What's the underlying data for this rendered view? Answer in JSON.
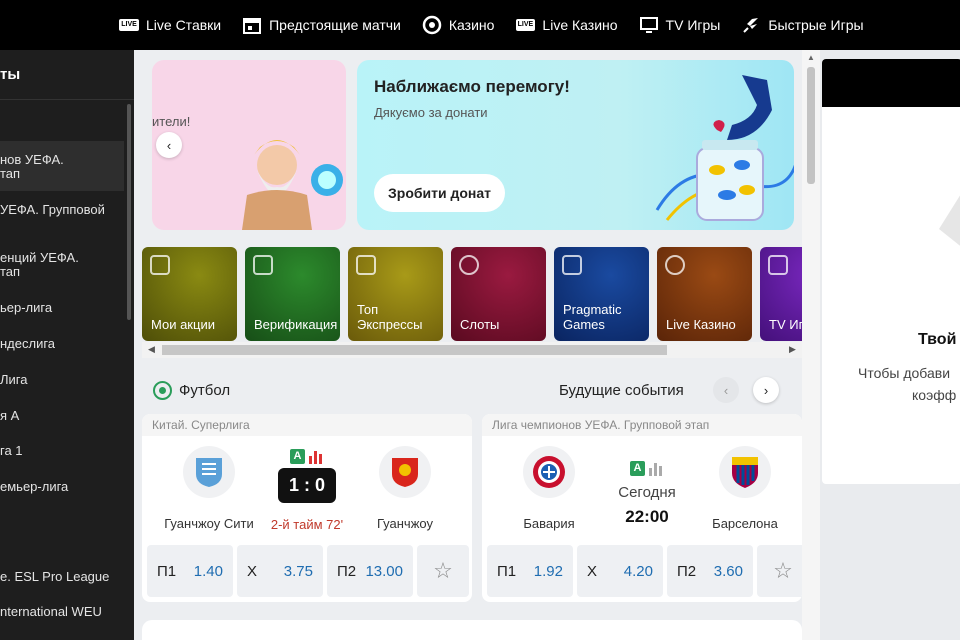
{
  "top_nav": [
    {
      "label": "Live Ставки",
      "icon": "live-badge-icon"
    },
    {
      "label": "Предстоящие матчи",
      "icon": "calendar-icon"
    },
    {
      "label": "Казино",
      "icon": "casino-chip-icon"
    },
    {
      "label": "Live Казино",
      "icon": "live-badge-icon"
    },
    {
      "label": "TV Игры",
      "icon": "tv-icon"
    },
    {
      "label": "Быстрые Игры",
      "icon": "rocket-icon"
    }
  ],
  "live_badge_text": "LIVE",
  "sidebar": {
    "title": "ты",
    "items": [
      "нов УЕФА.",
      "тап",
      " УЕФА. Групповой",
      "енций УЕФА.",
      "тап",
      "ьер-лига",
      "ндеслига",
      "Лига",
      "я А",
      "га 1",
      "емьер-лига",
      "e. ESL Pro League",
      "nternational WEU"
    ]
  },
  "banner_left": {
    "text": "ители!",
    "arrow": "‹"
  },
  "banner_right": {
    "title": "Наближаємо перемогу!",
    "subtitle": "Дякуємо за донати",
    "button": "Зробити донат"
  },
  "tiles": [
    {
      "label": "Мои акции",
      "color": "#6b6a0e"
    },
    {
      "label": "Верификация",
      "color": "#1f6c1f"
    },
    {
      "label": "Топ\nЭкспрессы",
      "color": "#8a7a10"
    },
    {
      "label": "Слоты",
      "color": "#7a1230"
    },
    {
      "label": "Pragmatic\nGames",
      "color": "#123a7a"
    },
    {
      "label": "Live Казино",
      "color": "#7a3a10"
    },
    {
      "label": "TV Иг",
      "color": "#5a1890"
    }
  ],
  "sport": {
    "title": "Футбол",
    "future_label": "Будущие события",
    "prev": "‹",
    "next": "›"
  },
  "matches": [
    {
      "league": "Китай. Суперлига",
      "home": "Гуанчжоу Сити",
      "away": "Гуанчжоу",
      "score": "1 : 0",
      "status": "2-й тайм 72'",
      "badge": "A",
      "odds": [
        {
          "k": "П1",
          "v": "1.40"
        },
        {
          "k": "Х",
          "v": "3.75"
        },
        {
          "k": "П2",
          "v": "13.00"
        }
      ]
    },
    {
      "league": "Лига чемпионов УЕФА. Групповой этап",
      "home": "Бавария",
      "away": "Барселона",
      "date": "Сегодня",
      "time": "22:00",
      "badge": "A",
      "odds": [
        {
          "k": "П1",
          "v": "1.92"
        },
        {
          "k": "Х",
          "v": "4.20"
        },
        {
          "k": "П2",
          "v": "3.60"
        }
      ]
    }
  ],
  "star": "☆",
  "right_panel": {
    "title": "Твой",
    "text_line1": "Чтобы добави",
    "text_line2": "коэфф"
  },
  "colors": {
    "accent": "#2a9d5a",
    "odds": "#1f6db1",
    "live": "#c0392b"
  }
}
